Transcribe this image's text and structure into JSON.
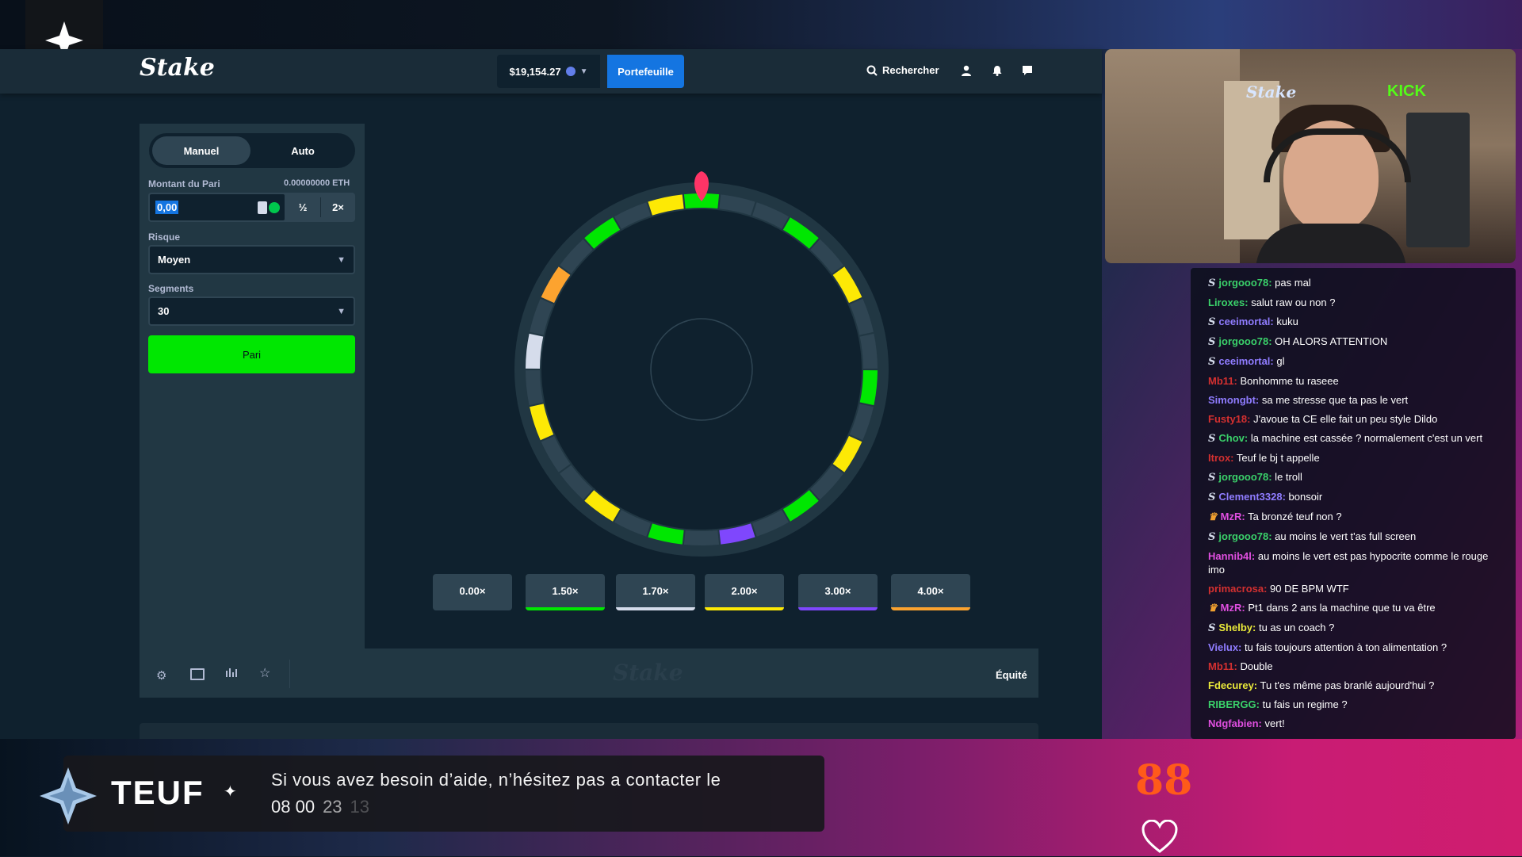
{
  "stream": {
    "overlay_name": "TEUF",
    "notice_text": "Si vous avez besoin d’aide, n’hésitez pas a contacter le",
    "notice_phone_part1": "08 00",
    "notice_phone_part2": "23",
    "notice_phone_part3": "13",
    "heart_rate": "88",
    "webcam_brand_stake": "Stake",
    "webcam_brand_kick": "KICK"
  },
  "header": {
    "logo": "Stake",
    "balance": "$19,154.27",
    "wallet_label": "Portefeuille",
    "search_label": "Rechercher"
  },
  "panel": {
    "tab_manual": "Manuel",
    "tab_auto": "Auto",
    "bet_amount_label": "Montant du Pari",
    "bet_amount_crypto": "0.00000000 ETH",
    "bet_amount_value": "0,00",
    "half_label": "½",
    "double_label": "2×",
    "risk_label": "Risque",
    "risk_value": "Moyen",
    "segments_label": "Segments",
    "segments_value": "30",
    "bet_button": "Pari"
  },
  "wheel": {
    "segment_colors": [
      "green",
      "grey",
      "grey",
      "green",
      "grey",
      "yellow",
      "grey",
      "grey",
      "green",
      "grey",
      "yellow",
      "grey",
      "green",
      "grey",
      "violet",
      "grey",
      "green",
      "grey",
      "yellow",
      "grey",
      "grey",
      "yellow",
      "grey",
      "white",
      "grey",
      "orange",
      "grey",
      "green",
      "grey",
      "yellow"
    ],
    "palette": {
      "grey": "#2f4553",
      "green": "#00e701",
      "yellow": "#fde905",
      "white": "#d5dceb",
      "violet": "#7f47fd",
      "orange": "#fca32f"
    }
  },
  "multipliers": [
    {
      "label": "0.00×",
      "color": "#2f4553"
    },
    {
      "label": "1.50×",
      "color": "#00e701"
    },
    {
      "label": "1.70×",
      "color": "#d5dceb"
    },
    {
      "label": "2.00×",
      "color": "#fde905"
    },
    {
      "label": "3.00×",
      "color": "#7f47fd"
    },
    {
      "label": "4.00×",
      "color": "#fca32f"
    }
  ],
  "footer": {
    "watermark": "Stake",
    "fairness": "Équité"
  },
  "chat": {
    "messages": [
      {
        "badge": "S",
        "user": "jorgooo78",
        "text": "pas mal",
        "color": "#3ad16a"
      },
      {
        "badge": "",
        "user": "Liroxes",
        "text": "salut raw ou non ?",
        "color": "#3ad16a"
      },
      {
        "badge": "S",
        "user": "ceeimortal",
        "text": "kuku",
        "color": "#8f7cff"
      },
      {
        "badge": "S",
        "user": "jorgooo78",
        "text": "OH ALORS ATTENTION",
        "color": "#3ad16a"
      },
      {
        "badge": "S",
        "user": "ceeimortal",
        "text": "gl",
        "color": "#8f7cff"
      },
      {
        "badge": "",
        "user": "Mb11",
        "text": "Bonhomme tu raseee",
        "color": "#d43030"
      },
      {
        "badge": "",
        "user": "Simongbt",
        "text": "sa me stresse que ta pas le vert",
        "color": "#8f7cff"
      },
      {
        "badge": "",
        "user": "Fusty18",
        "text": "J'avoue ta CE elle fait un peu style Dildo",
        "color": "#d43030"
      },
      {
        "badge": "S",
        "user": "Chov",
        "text": "la machine est cassée ? normalement c'est un vert",
        "color": "#3ad16a"
      },
      {
        "badge": "",
        "user": "Itrox",
        "text": "Teuf le bj t appelle",
        "color": "#d43030"
      },
      {
        "badge": "S",
        "user": "jorgooo78",
        "text": "le troll",
        "color": "#3ad16a"
      },
      {
        "badge": "S",
        "user": "Clement3328",
        "text": "bonsoir",
        "color": "#8f7cff"
      },
      {
        "badge": "♛",
        "user": "MzR",
        "text": "Ta bronzé teuf non ?",
        "color": "#e04fe0"
      },
      {
        "badge": "S",
        "user": "jorgooo78",
        "text": "au moins le vert t'as full screen",
        "color": "#3ad16a"
      },
      {
        "badge": "",
        "user": "Hannib4l",
        "text": "au moins le vert est pas hypocrite comme le rouge imo",
        "color": "#e04fe0"
      },
      {
        "badge": "",
        "user": "primacrosa",
        "text": "90 DE BPM WTF",
        "color": "#d43030"
      },
      {
        "badge": "♛",
        "user": "MzR",
        "text": "Pt1 dans 2 ans la machine que tu va être",
        "color": "#e04fe0"
      },
      {
        "badge": "S",
        "user": "Shelby",
        "text": "tu as un coach ?",
        "color": "#e8e83a"
      },
      {
        "badge": "",
        "user": "Vielux",
        "text": "tu fais toujours attention à ton alimentation ?",
        "color": "#8f7cff"
      },
      {
        "badge": "",
        "user": "Mb11",
        "text": "Double",
        "color": "#d43030"
      },
      {
        "badge": "",
        "user": "Fdecurey",
        "text": "Tu t'es même pas branlé aujourd'hui ?",
        "color": "#e8e83a"
      },
      {
        "badge": "",
        "user": "RIBERGG",
        "text": "tu fais un regime ?",
        "color": "#3ad16a"
      },
      {
        "badge": "",
        "user": "Ndgfabien",
        "text": "vert!",
        "color": "#e04fe0"
      }
    ]
  }
}
